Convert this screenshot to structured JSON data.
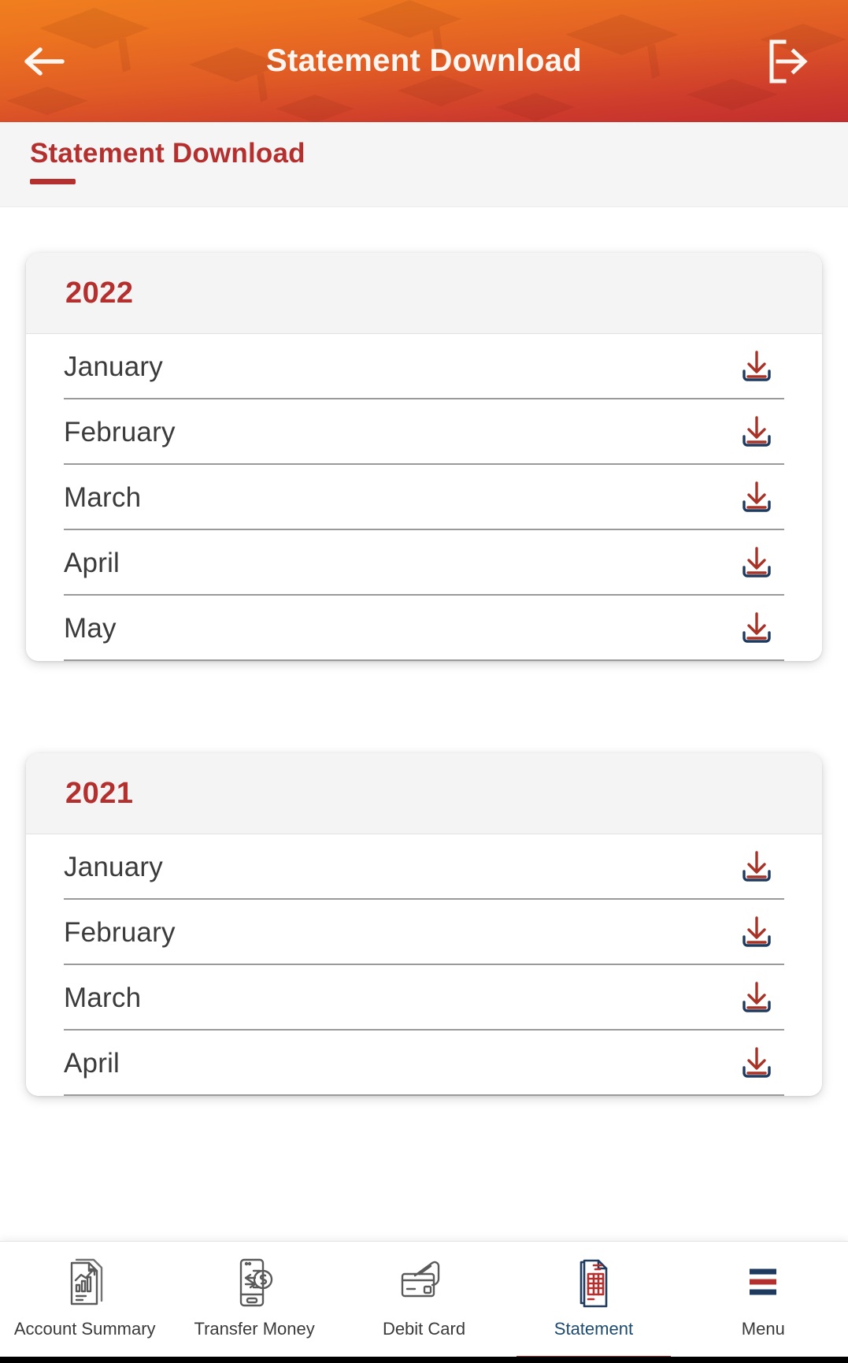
{
  "appbar": {
    "title": "Statement Download",
    "back_icon": "arrow-left-icon",
    "logout_icon": "logout-icon"
  },
  "tab": {
    "label": "Statement Download"
  },
  "colors": {
    "brand_red": "#B4302F",
    "brand_navy": "#1E4A6E",
    "gradient_start": "#F07E1E",
    "gradient_end": "#C22E2E",
    "card_header_bg": "#F4F4F4",
    "divider": "#9A9A9A"
  },
  "sections": [
    {
      "year": "2022",
      "months": [
        {
          "name": "January",
          "action": "download"
        },
        {
          "name": "February",
          "action": "download"
        },
        {
          "name": "March",
          "action": "download"
        },
        {
          "name": "April",
          "action": "download"
        },
        {
          "name": "May",
          "action": "download"
        }
      ]
    },
    {
      "year": "2021",
      "months": [
        {
          "name": "January",
          "action": "download"
        },
        {
          "name": "February",
          "action": "download"
        },
        {
          "name": "March",
          "action": "download"
        },
        {
          "name": "April",
          "action": "download"
        }
      ]
    }
  ],
  "bottom_nav": {
    "items": [
      {
        "label": "Account Summary",
        "icon": "account-summary-icon",
        "active": false
      },
      {
        "label": "Transfer Money",
        "icon": "transfer-money-icon",
        "active": false
      },
      {
        "label": "Debit Card",
        "icon": "debit-card-icon",
        "active": false
      },
      {
        "label": "Statement",
        "icon": "statement-icon",
        "active": true
      },
      {
        "label": "Menu",
        "icon": "hamburger-menu-icon",
        "active": false
      }
    ]
  }
}
